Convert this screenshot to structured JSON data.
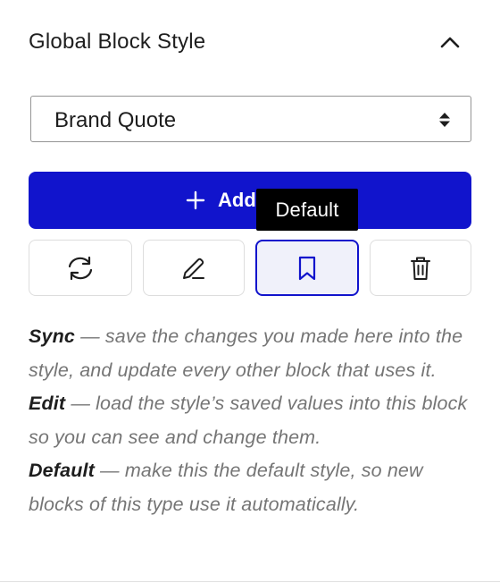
{
  "panel": {
    "title": "Global Block Style",
    "collapse_icon": "chevron-up-icon"
  },
  "style_select": {
    "selected_value": "Brand Quote",
    "arrow_icon": "up-down-arrows-icon"
  },
  "add_button": {
    "label": "Add",
    "icon": "plus-icon",
    "color": "#1114cc"
  },
  "actions": [
    {
      "name": "sync",
      "icon": "sync-icon"
    },
    {
      "name": "edit",
      "icon": "pencil-icon"
    },
    {
      "name": "default",
      "icon": "bookmark-icon",
      "active": true
    },
    {
      "name": "delete",
      "icon": "trash-icon"
    }
  ],
  "tooltip": {
    "text": "Default"
  },
  "help": [
    {
      "term": "Sync",
      "text": " — save the changes you made here into the style, and update every other block that uses it."
    },
    {
      "term": "Edit",
      "text": " — load the style’s saved values into this block so you can see and change them."
    },
    {
      "term": "Default",
      "text": " — make this the default style, so new blocks of this type use it automatically."
    }
  ]
}
